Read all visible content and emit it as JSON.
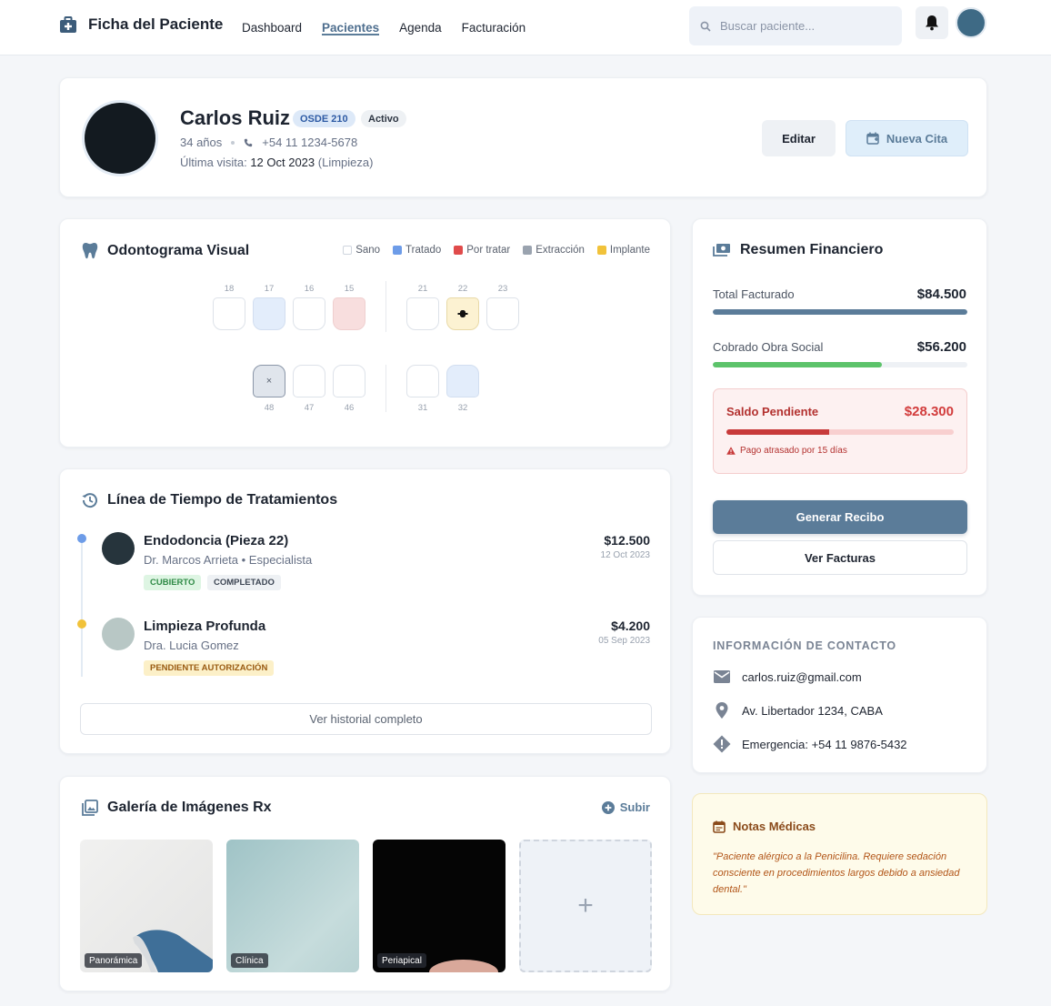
{
  "app": {
    "title": "Ficha del Paciente"
  },
  "nav": {
    "links": [
      {
        "label": "Dashboard",
        "active": false
      },
      {
        "label": "Pacientes",
        "active": true
      },
      {
        "label": "Agenda",
        "active": false
      },
      {
        "label": "Facturación",
        "active": false
      }
    ],
    "search_placeholder": "Buscar paciente...",
    "bell_icon": "bell-icon",
    "colors": {
      "accent": "#5b7c99"
    }
  },
  "patient": {
    "name": "Carlos Ruiz",
    "insurance_badge": "OSDE 210",
    "status_badge": "Activo",
    "age": "34 años",
    "phone": "+54 11 1234-5678",
    "last_visit_label": "Última visita:",
    "last_visit_date": "12 Oct 2023",
    "last_visit_reason": "(Limpieza)",
    "edit_label": "Editar",
    "new_appointment_label": "Nueva Cita"
  },
  "odontogram": {
    "title": "Odontograma Visual",
    "legend": [
      {
        "label": "Sano",
        "color": "#ffffff"
      },
      {
        "label": "Tratado",
        "color": "#6d9ce8"
      },
      {
        "label": "Por tratar",
        "color": "#e04b4b"
      },
      {
        "label": "Extracción",
        "color": "#9aa3af"
      },
      {
        "label": "Implante",
        "color": "#f1c23a"
      }
    ],
    "upper_right": [
      {
        "num": "18",
        "state": "sano",
        "mark": ""
      },
      {
        "num": "17",
        "state": "tratado",
        "mark": ""
      },
      {
        "num": "16",
        "state": "sano",
        "mark": ""
      },
      {
        "num": "15",
        "state": "portratar",
        "mark": ""
      }
    ],
    "upper_left": [
      {
        "num": "21",
        "state": "sano",
        "mark": ""
      },
      {
        "num": "22",
        "state": "implante",
        "mark": ""
      },
      {
        "num": "23",
        "state": "sano",
        "mark": ""
      }
    ],
    "lower_right": [
      {
        "num": "48",
        "state": "extraccion",
        "mark": "×"
      },
      {
        "num": "47",
        "state": "sano",
        "mark": ""
      },
      {
        "num": "46",
        "state": "sano",
        "mark": ""
      }
    ],
    "lower_left": [
      {
        "num": "31",
        "state": "sano",
        "mark": ""
      },
      {
        "num": "32",
        "state": "tratado",
        "mark": ""
      }
    ]
  },
  "timeline": {
    "title": "Línea de Tiempo de Tratamientos",
    "items": [
      {
        "title": "Endodoncia (Pieza 22)",
        "doctor": "Dr. Marcos Arrieta • Especialista",
        "price": "$12.500",
        "date": "12 Oct 2023",
        "tags": [
          {
            "label": "CUBIERTO",
            "bg": "#def5e3",
            "fg": "#2f8a46"
          },
          {
            "label": "COMPLETADO",
            "bg": "#eef1f4",
            "fg": "#3d4654"
          }
        ],
        "dot_color": "#6d9ce8",
        "avatar_color": "#26343c"
      },
      {
        "title": "Limpieza Profunda",
        "doctor": "Dra. Lucia Gomez",
        "price": "$4.200",
        "date": "05 Sep 2023",
        "tags": [
          {
            "label": "PENDIENTE AUTORIZACIÓN",
            "bg": "#fcf0c8",
            "fg": "#9a5b12"
          }
        ],
        "dot_color": "#f1c23a",
        "avatar_color": "#b8c7c5"
      }
    ],
    "history_button": "Ver historial completo"
  },
  "gallery": {
    "title": "Galería de Imágenes Rx",
    "upload_label": "Subir",
    "add_symbol": "+",
    "images": [
      {
        "label": "Panorámica"
      },
      {
        "label": "Clínica"
      },
      {
        "label": "Periapical"
      }
    ]
  },
  "finance": {
    "title": "Resumen Financiero",
    "total_label": "Total Facturado",
    "total_value": "$84.500",
    "total_fill": 1.0,
    "paid_label": "Cobrado Obra Social",
    "paid_value": "$56.200",
    "paid_fill": 0.665,
    "pending_label": "Saldo Pendiente",
    "pending_value": "$28.300",
    "pending_fill": 0.45,
    "overdue_text": "Pago atrasado por 15 días",
    "receipt_button": "Generar Recibo",
    "invoices_button": "Ver Facturas",
    "colors": {
      "total": "#5b7c99",
      "paid": "#5cc36a",
      "pending": "#d63e3e"
    }
  },
  "contact": {
    "title": "INFORMACIÓN DE CONTACTO",
    "email": "carlos.ruiz@gmail.com",
    "address": "Av. Libertador 1234, CABA",
    "emergency": "Emergencia: +54 11 9876-5432"
  },
  "notes": {
    "title": "Notas Médicas",
    "text": "\"Paciente alérgico a la Penicilina. Requiere sedación consciente en procedimientos largos debido a ansiedad dental.\""
  }
}
